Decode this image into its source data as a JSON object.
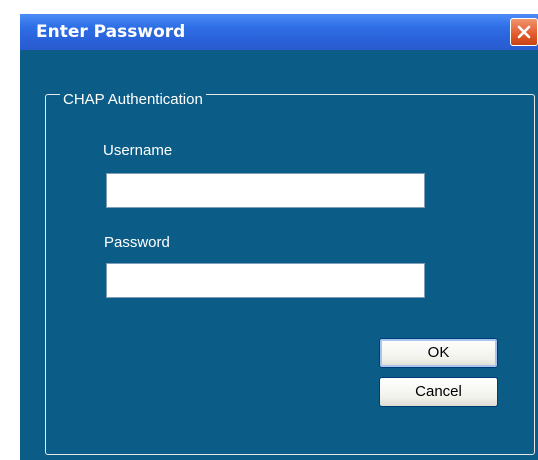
{
  "window": {
    "title": "Enter Password",
    "close_icon": "close-icon"
  },
  "group": {
    "label": "CHAP Authentication"
  },
  "fields": {
    "username_label": "Username",
    "username_value": "",
    "password_label": "Password",
    "password_value": ""
  },
  "buttons": {
    "ok_label": "OK",
    "cancel_label": "Cancel"
  },
  "colors": {
    "dialog_bg": "#0b5d87",
    "titlebar": "#2f6fe6",
    "close_button": "#e25a2c"
  }
}
